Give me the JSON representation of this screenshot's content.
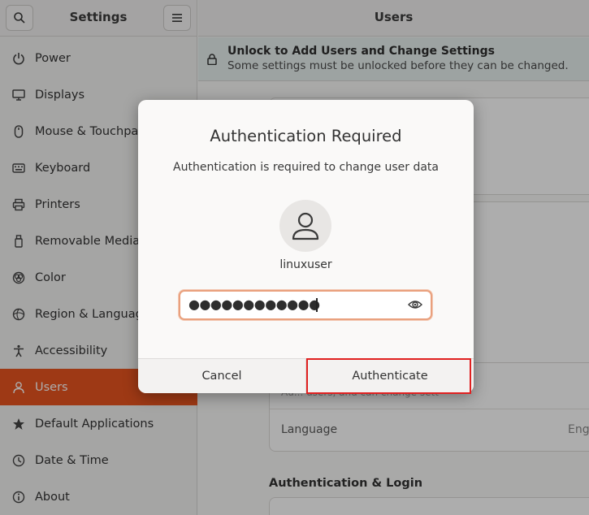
{
  "sidebar": {
    "title": "Settings",
    "items": [
      {
        "label": "Power",
        "icon": "power-icon"
      },
      {
        "label": "Displays",
        "icon": "display-icon"
      },
      {
        "label": "Mouse & Touchpad",
        "icon": "mouse-icon"
      },
      {
        "label": "Keyboard",
        "icon": "keyboard-icon"
      },
      {
        "label": "Printers",
        "icon": "printer-icon"
      },
      {
        "label": "Removable Media",
        "icon": "removable-media-icon"
      },
      {
        "label": "Color",
        "icon": "color-icon"
      },
      {
        "label": "Region & Language",
        "icon": "globe-icon"
      },
      {
        "label": "Accessibility",
        "icon": "accessibility-icon"
      },
      {
        "label": "Users",
        "icon": "user-icon",
        "active": true
      },
      {
        "label": "Default Applications",
        "icon": "star-icon"
      },
      {
        "label": "Date & Time",
        "icon": "clock-icon"
      },
      {
        "label": "About",
        "icon": "info-icon"
      }
    ]
  },
  "main": {
    "title": "Users",
    "unlock": {
      "title": "Unlock to Add Users and Change Settings",
      "subtitle": "Some settings must be unlocked before they can be changed."
    },
    "faded_text": "Au... users, and can change sett",
    "language_label": "Language",
    "language_value": "Eng",
    "auth_section": "Authentication & Login"
  },
  "dialog": {
    "title": "Authentication Required",
    "subtitle": "Authentication is required to change user data",
    "username": "linuxuser",
    "password_mask": "●●●●●●●●●●●●",
    "cancel_label": "Cancel",
    "authenticate_label": "Authenticate"
  },
  "colors": {
    "accent": "#e95420",
    "highlight": "#e02020",
    "focus_border": "#e9a07d"
  }
}
